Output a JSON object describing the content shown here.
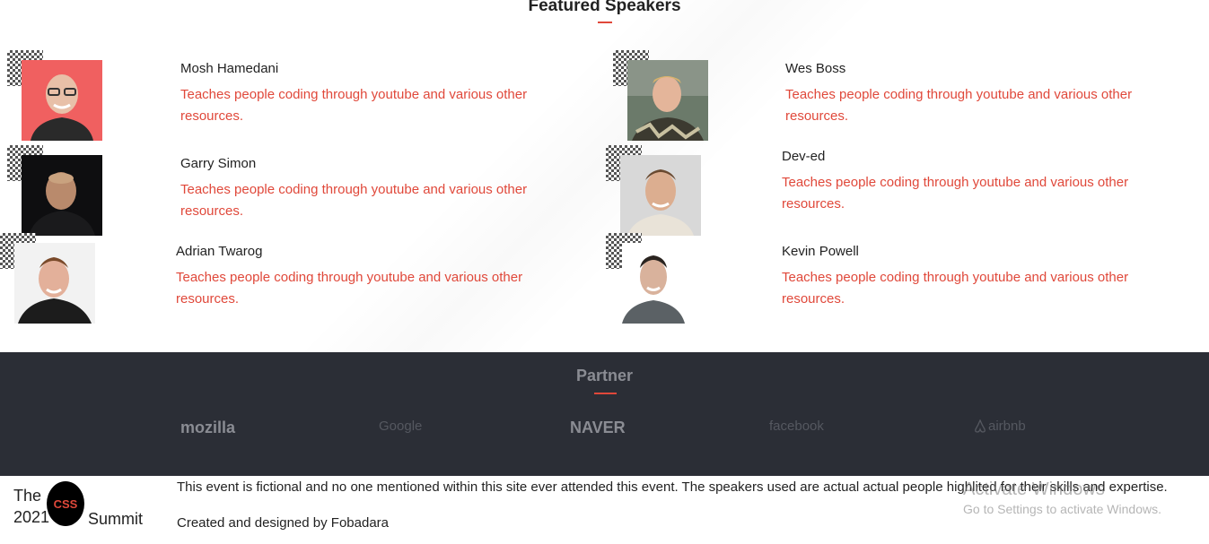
{
  "featured": {
    "title": "Featured Speakers",
    "speakers": [
      {
        "name": "Mosh Hamedani",
        "desc": "Teaches people coding through youtube and various other resources."
      },
      {
        "name": "Wes Boss",
        "desc": "Teaches people coding through youtube and various other resources."
      },
      {
        "name": "Garry Simon",
        "desc": "Teaches people coding through youtube and various other resources."
      },
      {
        "name": "Dev-ed",
        "desc": "Teaches people coding through youtube and various other resources."
      },
      {
        "name": "Adrian Twarog",
        "desc": "Teaches people coding through youtube and various other resources."
      },
      {
        "name": "Kevin Powell",
        "desc": "Teaches people coding through youtube and various other resources."
      }
    ]
  },
  "partner": {
    "title": "Partner",
    "logos": [
      "mozilla",
      "Google",
      "NAVER",
      "facebook",
      "airbnb"
    ]
  },
  "footer": {
    "brand_the": "The",
    "brand_year": "2021",
    "brand_badge": "CSS",
    "brand_summit": "Summit",
    "disclaimer": "This event is fictional and no one mentioned within this site ever attended this event. The speakers used are actual actual people highlited for their skills and expertise.",
    "credit": "Created and designed by Fobadara"
  },
  "watermark": {
    "line1": "Activate Windows",
    "line2": "Go to Settings to activate Windows."
  },
  "colors": {
    "accent": "#e0483a",
    "partner_bg": "#2b2e36"
  }
}
